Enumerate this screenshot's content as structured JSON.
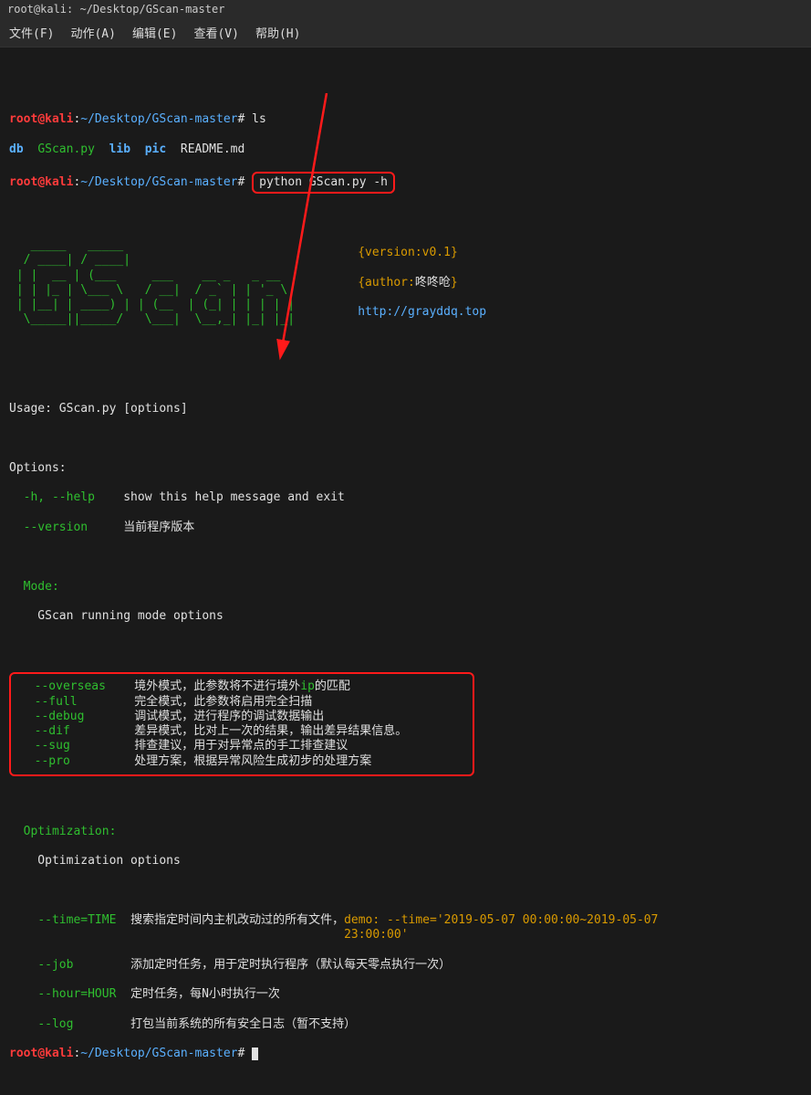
{
  "titlebar": "root@kali: ~/Desktop/GScan-master",
  "menu": {
    "file": "文件(F)",
    "action": "动作(A)",
    "edit": "编辑(E)",
    "view": "查看(V)",
    "help": "帮助(H)"
  },
  "prompt": {
    "user": "root",
    "host": "kali",
    "sep": "@",
    "colon": ":",
    "path": "~/Desktop/GScan-master",
    "hash": "#"
  },
  "cmd1": "ls",
  "ls": {
    "db": "db",
    "gscan": "GScan.py",
    "lib": "lib",
    "pic": "pic",
    "readme": "README.md"
  },
  "cmd2": "python GScan.py -h",
  "ascii": "   _____   _____                             \n  / ____| / ____|                            \n | |  __ | (___     ___    __ _   _ __      \n | | |_ | \\___ \\   / __|  / _` | | '_ \\     \n | |__| | ____) | | (__  | (_| | | | | |    \n  \\_____||_____/   \\___|  \\__,_| |_| |_|    ",
  "meta": {
    "version": "{version:v0.1}",
    "author_open": "{author:",
    "author_name": "咚咚呛",
    "author_close": "}",
    "url": "http://grayddq.top"
  },
  "usage": "Usage: GScan.py [options]",
  "options_hdr": "Options:",
  "help_flag": "  -h, --help",
  "help_desc": "show this help message and exit",
  "version_flag": "  --version",
  "version_desc": "当前程序版本",
  "mode_hdr": "  Mode:",
  "mode_sub": "    GScan running mode options",
  "mode_opts": {
    "overseas_flag": "--overseas",
    "overseas_desc_a": "境外模式，此参数将不进行境外",
    "overseas_ip": "ip",
    "overseas_desc_b": "的匹配",
    "full_flag": "--full",
    "full_desc": "完全模式，此参数将启用完全扫描",
    "debug_flag": "--debug",
    "debug_desc": "调试模式，进行程序的调试数据输出",
    "dif_flag": "--dif",
    "dif_desc": "差异模式，比对上一次的结果，输出差异结果信息。",
    "sug_flag": "--sug",
    "sug_desc": "排查建议，用于对异常点的手工排查建议",
    "pro_flag": "--pro",
    "pro_desc": "处理方案，根据异常风险生成初步的处理方案"
  },
  "opt_hdr": "  Optimization:",
  "opt_sub": "    Optimization options",
  "opt_opts": {
    "time_flag": "--time=TIME",
    "time_desc": "搜索指定时间内主机改动过的所有文件，",
    "time_demo": "demo: --time='2019-05-07 00:00:00~2019-05-07 23:00:00'",
    "job_flag": "--job",
    "job_desc": "添加定时任务，用于定时执行程序（默认每天零点执行一次）",
    "hour_flag": "--hour=HOUR",
    "hour_desc": "定时任务，每N小时执行一次",
    "log_flag": "--log",
    "log_desc": "打包当前系统的所有安全日志（暂不支持）"
  }
}
